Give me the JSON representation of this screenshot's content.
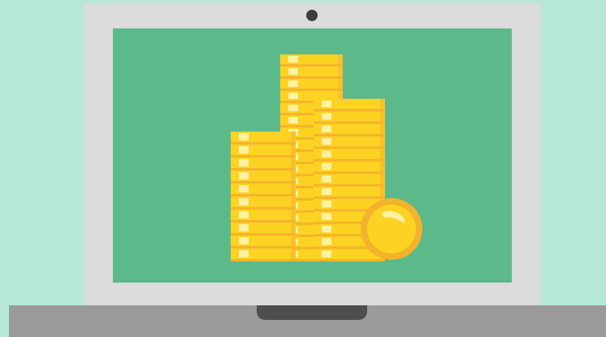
{
  "illustration": {
    "subject": "laptop-with-coin-stacks-icon",
    "colors": {
      "background": "#b7e8d6",
      "laptop_bezel": "#dcdcdc",
      "screen": "#5cb98a",
      "camera": "#3c3c3c",
      "laptop_base": "#9a9a9a",
      "base_notch": "#4e4e4e",
      "coin_face": "#fcd322",
      "coin_edge": "#f6b32b",
      "coin_shine": "#fff1a2",
      "coin_outline": "#f2b42c"
    },
    "stacks": [
      {
        "name": "left-stack",
        "coins": 10
      },
      {
        "name": "middle-stack",
        "coins": 17
      },
      {
        "name": "right-stack",
        "coins": 13
      }
    ],
    "single_coin": true
  }
}
